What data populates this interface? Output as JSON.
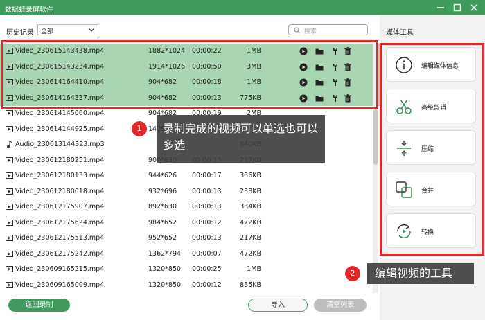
{
  "app": {
    "title": "数据蛙录屏软件"
  },
  "toolbar": {
    "history_label": "历史记录",
    "history_filter": "全部",
    "search_placeholder": "搜索"
  },
  "files": [
    {
      "name": "Video_230615143438.mp4",
      "resolution": "1882*1024",
      "duration": "00:00:22",
      "size": "1MB"
    },
    {
      "name": "Video_230615143234.mp4",
      "resolution": "1914*1026",
      "duration": "00:00:50",
      "size": "3MB"
    },
    {
      "name": "Video_230614164410.mp4",
      "resolution": "904*682",
      "duration": "00:00:18",
      "size": "1MB"
    },
    {
      "name": "Video_230614164337.mp4",
      "resolution": "904*682",
      "duration": "00:00:13",
      "size": "775KB"
    },
    {
      "name": "Video_230614145000.mp4",
      "resolution": "904*682",
      "duration": "00:00:19",
      "size": "2MB"
    },
    {
      "name": "Video_230614144925.mp4",
      "resolution": "1406*",
      "duration": "",
      "size": ""
    },
    {
      "name": "Audio_230613144323.mp3",
      "resolution": "",
      "duration": "",
      "size": "840KB"
    },
    {
      "name": "Video_230612180251.mp4",
      "resolution": "900*630",
      "duration": "00:00:13",
      "size": "217KB"
    },
    {
      "name": "Video_230612180133.mp4",
      "resolution": "944*626",
      "duration": "00:00:17",
      "size": "336KB"
    },
    {
      "name": "Video_230612180018.mp4",
      "resolution": "932*696",
      "duration": "00:00:13",
      "size": "238KB"
    },
    {
      "name": "Video_230612175907.mp4",
      "resolution": "892*630",
      "duration": "00:00:13",
      "size": "334KB"
    },
    {
      "name": "Video_230612175624.mp4",
      "resolution": "984*652",
      "duration": "00:00:12",
      "size": "472KB"
    },
    {
      "name": "Video_230612175513.mp4",
      "resolution": "952*652",
      "duration": "00:00:13",
      "size": "217KB"
    },
    {
      "name": "Video_230612175242.mp4",
      "resolution": "1362*794",
      "duration": "00:00:07",
      "size": "472KB"
    },
    {
      "name": "Video_230609165215.mp4",
      "resolution": "1320*850",
      "duration": "00:00:25",
      "size": "1MB"
    },
    {
      "name": "Video_230609165009.mp4",
      "resolution": "1320*850",
      "duration": "00:00:12",
      "size": "835KB"
    }
  ],
  "media_tools": {
    "title": "媒体工具",
    "items": [
      {
        "label": "编辑媒体信息",
        "icon": "info-icon"
      },
      {
        "label": "高级剪辑",
        "icon": "scissors-icon"
      },
      {
        "label": "压缩",
        "icon": "compress-icon"
      },
      {
        "label": "合并",
        "icon": "merge-icon"
      },
      {
        "label": "转换",
        "icon": "convert-icon"
      }
    ]
  },
  "bottom": {
    "back_label": "返回录制",
    "import_label": "导入",
    "clear_label": "清空列表"
  },
  "annotations": [
    {
      "number": "1",
      "text": "录制完成的视频可以单选也可以多选"
    },
    {
      "number": "2",
      "text": "编辑视频的工具"
    }
  ],
  "colors": {
    "brand_green": "#3f9a5e",
    "selected_row": "#a8d6b2",
    "highlight_red": "#e3282b"
  }
}
